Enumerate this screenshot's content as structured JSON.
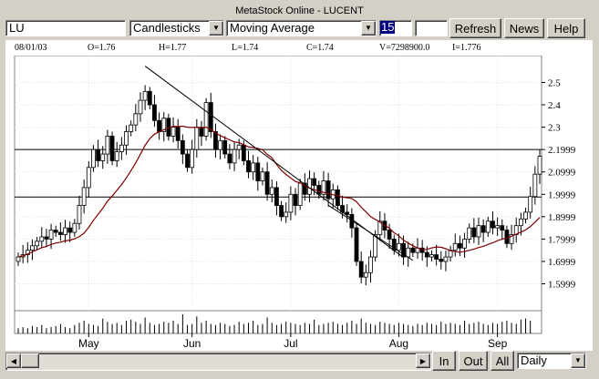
{
  "window": {
    "title": "MetaStock Online - LUCENT"
  },
  "toolbar": {
    "symbol_value": "LU",
    "chart_type": "Candlesticks",
    "indicator": "Moving Average",
    "period": "15",
    "refresh_label": "Refresh",
    "news_label": "News",
    "help_label": "Help"
  },
  "ohlc": {
    "date": "08/01/03",
    "open": "O=1.76",
    "high": "H=1.77",
    "low": "L=1.74",
    "close": "C=1.74",
    "volume": "V=7298900.0",
    "indicator_value": "I=1.776"
  },
  "bottom": {
    "in_label": "In",
    "out_label": "Out",
    "all_label": "All",
    "interval": "Daily"
  },
  "colors": {
    "ma": "#800000",
    "candle": "#000000",
    "ref_line": "#000000"
  },
  "icons": {
    "dropdown": "chevron-down-icon",
    "scroll_left": "arrow-left-icon",
    "scroll_right": "arrow-right-icon"
  },
  "chart_data": {
    "type": "candlestick",
    "yticks": [
      "2.5",
      "2.4",
      "2.3",
      "2.1999",
      "2.0999",
      "1.9999",
      "1.8999",
      "1.7999",
      "1.6999",
      "1.5999"
    ],
    "ytick_values": [
      2.5,
      2.4,
      2.3,
      2.2,
      2.1,
      2.0,
      1.9,
      1.8,
      1.7,
      1.6
    ],
    "ylim": [
      1.48,
      2.62
    ],
    "months": [
      {
        "label": "May",
        "index": 15
      },
      {
        "label": "Jun",
        "index": 37
      },
      {
        "label": "Jul",
        "index": 58
      },
      {
        "label": "Aug",
        "index": 81
      },
      {
        "label": "Sep",
        "index": 102
      }
    ],
    "horizontal_lines": [
      2.2,
      1.988
    ],
    "trendlines": [
      {
        "from": [
          27,
          2.573
        ],
        "to": [
          82,
          1.718
        ]
      },
      {
        "from": [
          66,
          1.951
        ],
        "to": [
          84,
          1.705
        ]
      }
    ],
    "close": [
      1.72,
      1.73,
      1.75,
      1.77,
      1.79,
      1.81,
      1.8,
      1.84,
      1.83,
      1.82,
      1.85,
      1.83,
      1.87,
      1.95,
      2.03,
      2.12,
      2.2,
      2.15,
      2.18,
      2.26,
      2.15,
      2.19,
      2.22,
      2.28,
      2.31,
      2.36,
      2.42,
      2.46,
      2.4,
      2.33,
      2.28,
      2.34,
      2.26,
      2.3,
      2.24,
      2.18,
      2.12,
      2.2,
      2.3,
      2.26,
      2.41,
      2.28,
      2.2,
      2.24,
      2.18,
      2.14,
      2.2,
      2.22,
      2.15,
      2.1,
      2.14,
      2.06,
      2.1,
      2.0,
      2.03,
      1.95,
      1.9,
      1.92,
      2.0,
      1.95,
      2.05,
      2.0,
      2.07,
      2.04,
      2.0,
      2.06,
      1.98,
      2.02,
      1.95,
      1.92,
      1.91,
      1.85,
      1.7,
      1.63,
      1.65,
      1.72,
      1.82,
      1.88,
      1.84,
      1.8,
      1.75,
      1.78,
      1.72,
      1.76,
      1.74,
      1.76,
      1.74,
      1.72,
      1.73,
      1.71,
      1.7,
      1.72,
      1.75,
      1.78,
      1.76,
      1.8,
      1.85,
      1.81,
      1.86,
      1.83,
      1.88,
      1.85,
      1.86,
      1.84,
      1.78,
      1.82,
      1.86,
      1.89,
      1.92,
      1.99,
      2.09,
      2.17
    ],
    "volume": [
      5,
      6,
      5,
      7,
      6,
      8,
      5,
      6,
      7,
      9,
      6,
      5,
      8,
      10,
      12,
      9,
      8,
      7,
      14,
      11,
      9,
      10,
      8,
      12,
      13,
      11,
      9,
      15,
      10,
      8,
      9,
      11,
      10,
      12,
      9,
      18,
      8,
      9,
      16,
      10,
      12,
      9,
      8,
      10,
      9,
      7,
      8,
      11,
      9,
      10,
      12,
      8,
      9,
      15,
      10,
      8,
      9,
      11,
      10,
      9,
      8,
      10,
      9,
      13,
      8,
      9,
      10,
      11,
      9,
      8,
      10,
      12,
      9,
      14,
      10,
      9,
      8,
      11,
      10,
      9,
      8,
      10,
      9,
      8,
      7,
      9,
      8,
      10,
      9,
      8,
      11,
      9,
      10,
      9,
      8,
      12,
      9,
      10,
      11,
      9,
      8,
      10,
      9,
      11,
      12,
      10,
      9,
      13,
      14,
      12
    ]
  }
}
